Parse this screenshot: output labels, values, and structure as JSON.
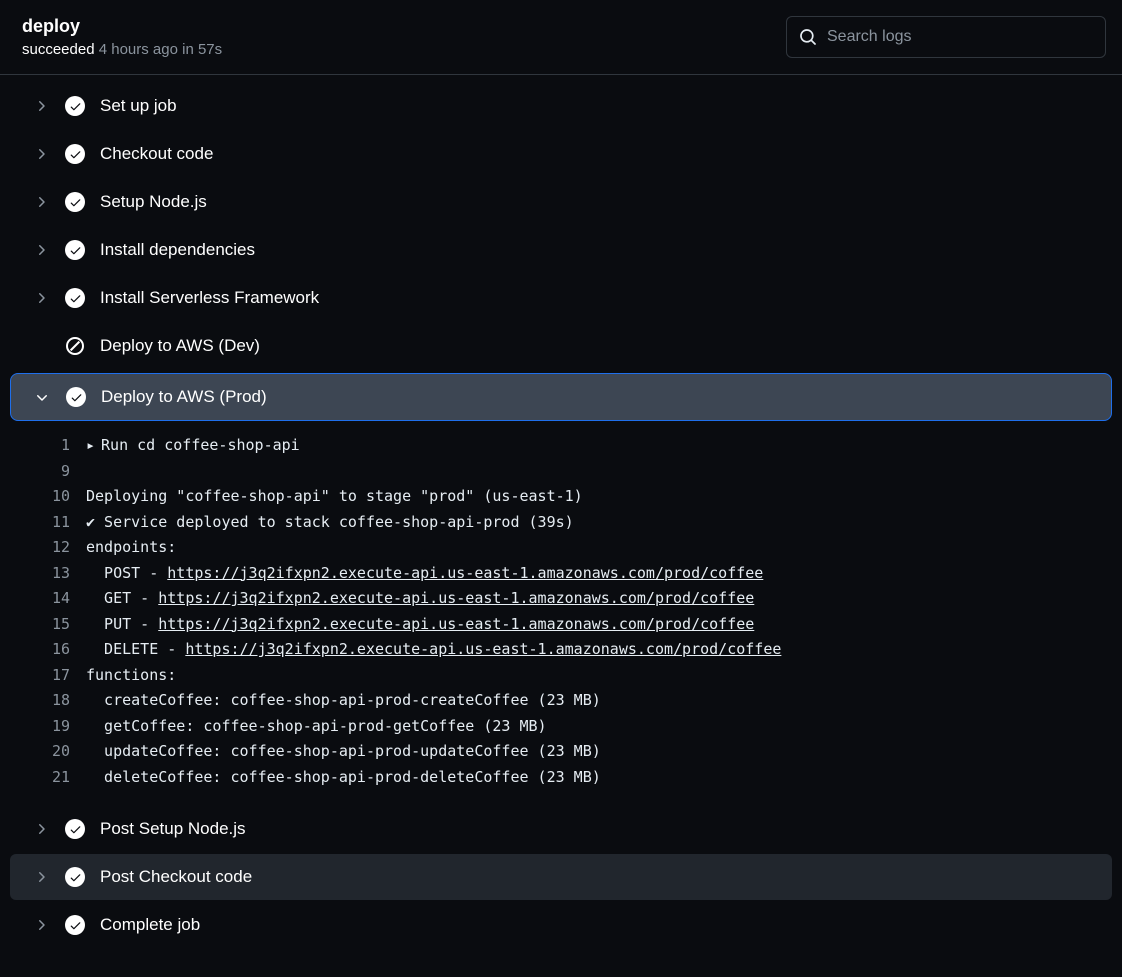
{
  "header": {
    "title": "deploy",
    "status_word": "succeeded",
    "status_rest": " 4 hours ago in 57s"
  },
  "search": {
    "placeholder": "Search logs",
    "value": ""
  },
  "steps": [
    {
      "label": "Set up job",
      "state": "success",
      "expanded": false
    },
    {
      "label": "Checkout code",
      "state": "success",
      "expanded": false
    },
    {
      "label": "Setup Node.js",
      "state": "success",
      "expanded": false
    },
    {
      "label": "Install dependencies",
      "state": "success",
      "expanded": false
    },
    {
      "label": "Install Serverless Framework",
      "state": "success",
      "expanded": false
    },
    {
      "label": "Deploy to AWS (Dev)",
      "state": "skipped",
      "expanded": false
    },
    {
      "label": "Deploy to AWS (Prod)",
      "state": "success",
      "expanded": true
    },
    {
      "label": "Post Setup Node.js",
      "state": "success",
      "expanded": false
    },
    {
      "label": "Post Checkout code",
      "state": "success",
      "expanded": false,
      "hover": true
    },
    {
      "label": "Complete job",
      "state": "success",
      "expanded": false
    }
  ],
  "log": {
    "lines": [
      {
        "no": "1",
        "disclosure": true,
        "text": "Run cd coffee-shop-api"
      },
      {
        "no": "9",
        "text": ""
      },
      {
        "no": "10",
        "text": "Deploying \"coffee-shop-api\" to stage \"prod\" (us-east-1)"
      },
      {
        "no": "11",
        "text": "✔ Service deployed to stack coffee-shop-api-prod (39s)"
      },
      {
        "no": "12",
        "text": "endpoints:"
      },
      {
        "no": "13",
        "prefix": "  POST - ",
        "link": "https://j3q2ifxpn2.execute-api.us-east-1.amazonaws.com/prod/coffee"
      },
      {
        "no": "14",
        "prefix": "  GET - ",
        "link": "https://j3q2ifxpn2.execute-api.us-east-1.amazonaws.com/prod/coffee"
      },
      {
        "no": "15",
        "prefix": "  PUT - ",
        "link": "https://j3q2ifxpn2.execute-api.us-east-1.amazonaws.com/prod/coffee"
      },
      {
        "no": "16",
        "prefix": "  DELETE - ",
        "link": "https://j3q2ifxpn2.execute-api.us-east-1.amazonaws.com/prod/coffee"
      },
      {
        "no": "17",
        "text": "functions:"
      },
      {
        "no": "18",
        "text": "  createCoffee: coffee-shop-api-prod-createCoffee (23 MB)"
      },
      {
        "no": "19",
        "text": "  getCoffee: coffee-shop-api-prod-getCoffee (23 MB)"
      },
      {
        "no": "20",
        "text": "  updateCoffee: coffee-shop-api-prod-updateCoffee (23 MB)"
      },
      {
        "no": "21",
        "text": "  deleteCoffee: coffee-shop-api-prod-deleteCoffee (23 MB)"
      }
    ]
  }
}
